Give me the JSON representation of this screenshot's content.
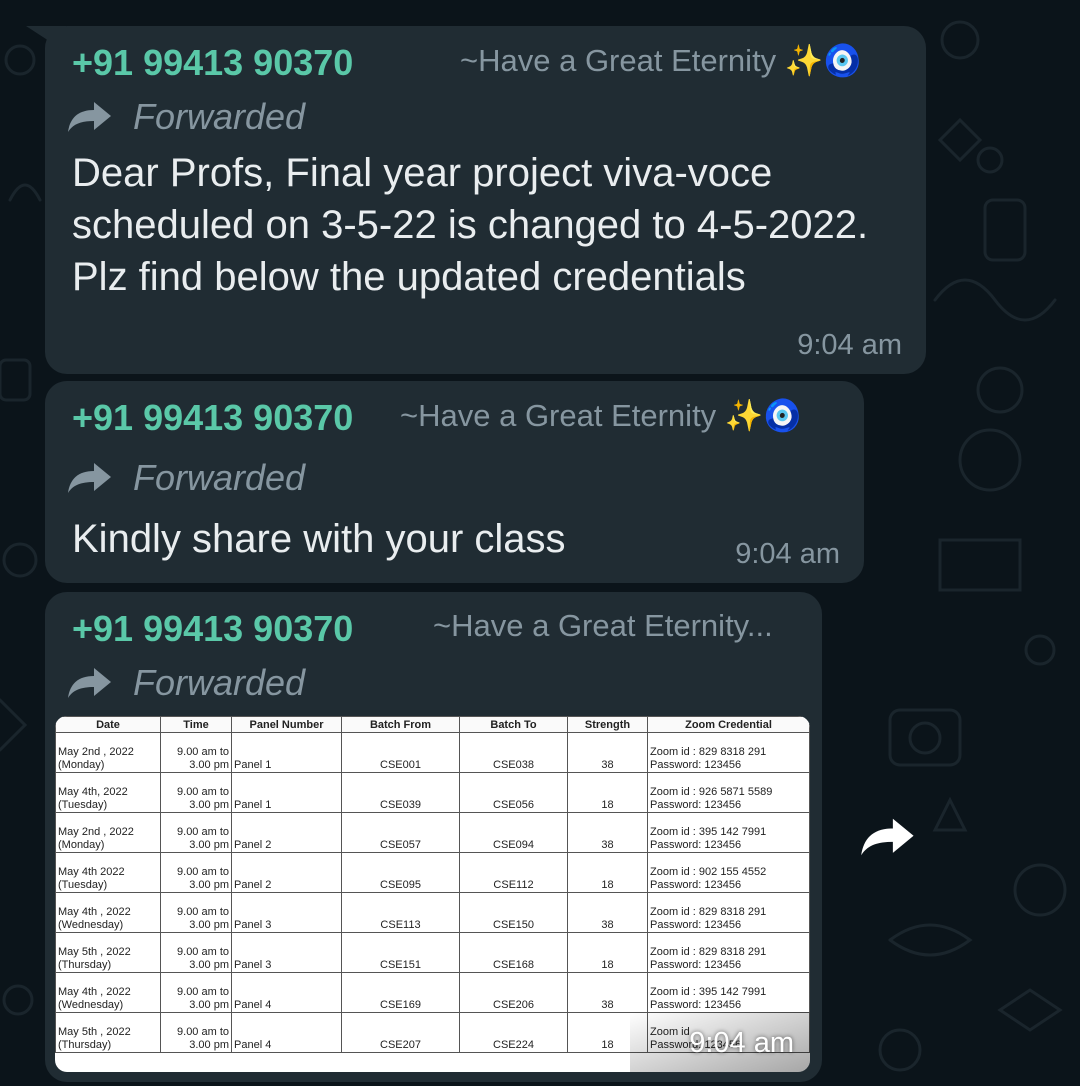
{
  "colors": {
    "background": "#0b141a",
    "bubble": "#202c33",
    "sender": "#5ac8a8",
    "meta": "#8696a0",
    "text": "#e9edef"
  },
  "messages": [
    {
      "sender": "+91 99413 90370",
      "pushname": "~Have a Great Eternity ✨🧿",
      "forwarded_label": "Forwarded",
      "text": "Dear Profs,  Final year project viva-voce scheduled on 3-5-22 is changed to 4-5-2022. Plz find below the updated credentials",
      "time": "9:04 am"
    },
    {
      "sender": "+91 99413 90370",
      "pushname": "~Have a Great Eternity ✨🧿",
      "forwarded_label": "Forwarded",
      "text": "Kindly share with your class",
      "time": "9:04 am"
    },
    {
      "sender": "+91 99413 90370",
      "pushname": "~Have a Great Eternity...",
      "forwarded_label": "Forwarded",
      "time": "9:04 am",
      "image_icon": "share-forward-icon",
      "table": {
        "headers": [
          "Date",
          "Time",
          "Panel Number",
          "Batch From",
          "Batch To",
          "Strength",
          "Zoom Credential"
        ],
        "rows": [
          [
            "May 2nd , 2022",
            "(Monday)",
            "9.00 am to",
            "3.00 pm",
            "Panel 1",
            "CSE001",
            "CSE038",
            "38",
            "Zoom id : 829 8318 291",
            "Password: 123456"
          ],
          [
            "May 4th, 2022",
            "(Tuesday)",
            "9.00 am to",
            "3.00 pm",
            "Panel 1",
            "CSE039",
            "CSE056",
            "18",
            "Zoom id : 926 5871 5589",
            "Password: 123456"
          ],
          [
            "May 2nd , 2022",
            "(Monday)",
            "9.00 am to",
            "3.00 pm",
            "Panel 2",
            "CSE057",
            "CSE094",
            "38",
            "Zoom id : 395 142 7991",
            "Password: 123456"
          ],
          [
            "May 4th 2022",
            "(Tuesday)",
            "9.00 am to",
            "3.00 pm",
            "Panel 2",
            "CSE095",
            "CSE112",
            "18",
            "Zoom id : 902 155 4552",
            "Password: 123456"
          ],
          [
            "May 4th , 2022",
            "(Wednesday)",
            "9.00 am to",
            "3.00 pm",
            "Panel 3",
            "CSE113",
            "CSE150",
            "38",
            "Zoom id : 829 8318 291",
            "Password: 123456"
          ],
          [
            "May 5th , 2022",
            "(Thursday)",
            "9.00 am to",
            "3.00 pm",
            "Panel 3",
            "CSE151",
            "CSE168",
            "18",
            "Zoom id : 829 8318 291",
            "Password: 123456"
          ],
          [
            "May 4th , 2022",
            "(Wednesday)",
            "9.00 am to",
            "3.00 pm",
            "Panel 4",
            "CSE169",
            "CSE206",
            "38",
            "Zoom id : 395 142 7991",
            "Password: 123456"
          ],
          [
            "May 5th , 2022",
            "(Thursday)",
            "9.00 am to",
            "3.00 pm",
            "Panel 4",
            "CSE207",
            "CSE224",
            "18",
            "Zoom id",
            "Password: 123456"
          ]
        ]
      }
    }
  ]
}
